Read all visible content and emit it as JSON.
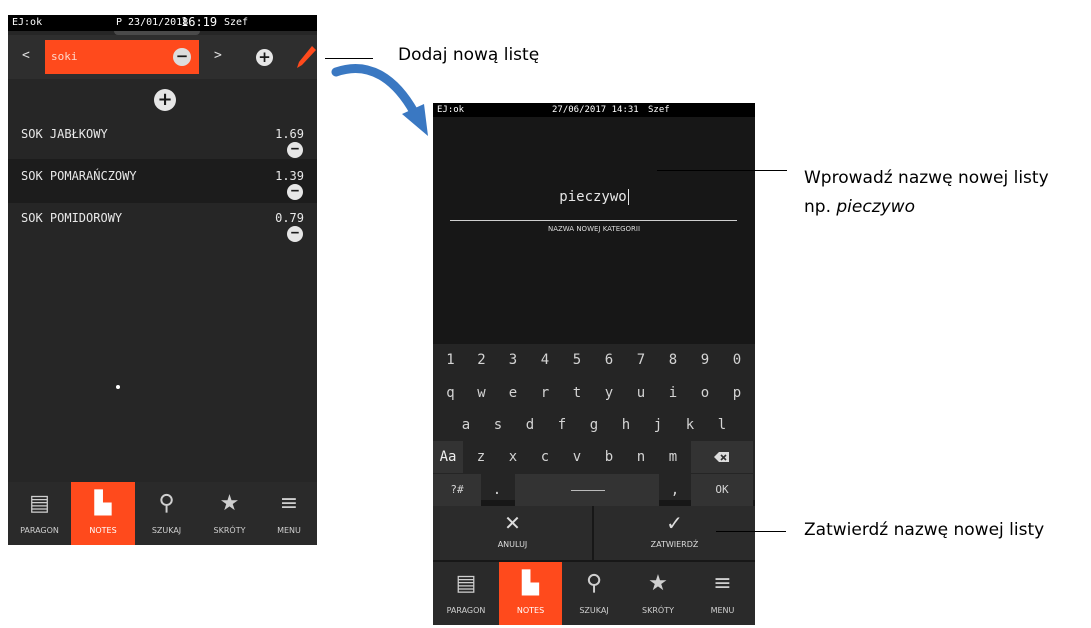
{
  "screen1": {
    "status": {
      "left": "EJ:ok",
      "mid": "P 23/01/2018",
      "time": "16:19",
      "user": "Szef"
    },
    "topbar": {
      "prev": "<",
      "list_name": "soki",
      "next": ">"
    },
    "items": [
      {
        "name": "SOK JABŁKOWY",
        "price": "1.69"
      },
      {
        "name": "SOK POMARAŃCZOWY",
        "price": "1.39"
      },
      {
        "name": "SOK POMIDOROWY",
        "price": "0.79"
      }
    ]
  },
  "screen2": {
    "status": {
      "left": "EJ:ok",
      "datetime": "27/06/2017 14:31",
      "user": "Szef"
    },
    "input_value": "pieczywo",
    "input_caption": "NAZWA NOWEJ KATEGORII",
    "keyboard": {
      "row1": [
        "1",
        "2",
        "3",
        "4",
        "5",
        "6",
        "7",
        "8",
        "9",
        "0"
      ],
      "row2": [
        "q",
        "w",
        "e",
        "r",
        "t",
        "y",
        "u",
        "i",
        "o",
        "p"
      ],
      "row3": [
        "a",
        "s",
        "d",
        "f",
        "g",
        "h",
        "j",
        "k",
        "l"
      ],
      "row4": [
        "z",
        "x",
        "c",
        "v",
        "b",
        "n",
        "m"
      ],
      "shift": "Aa",
      "sym": "?#",
      "dot": ".",
      "comma": ",",
      "ok": "OK"
    },
    "cancel_label": "ANULUJ",
    "confirm_label": "ZATWIERDŹ"
  },
  "nav": {
    "items": [
      {
        "label": "PARAGON",
        "icon": "receipt-icon"
      },
      {
        "label": "NOTES",
        "icon": "notes-icon",
        "active": true
      },
      {
        "label": "SZUKAJ",
        "icon": "search-icon"
      },
      {
        "label": "SKRÓTY",
        "icon": "star-icon"
      },
      {
        "label": "MENU",
        "icon": "menu-icon"
      }
    ]
  },
  "annotations": {
    "add_list": "Dodaj nową listę",
    "enter_name_line1": "Wprowadź nazwę nowej listy",
    "enter_name_prefix": "np. ",
    "enter_name_example": "pieczywo",
    "confirm_name": "Zatwierdź nazwę nowej listy"
  },
  "colors": {
    "accent": "#ff4a1c",
    "arrow": "#3a78c2"
  }
}
